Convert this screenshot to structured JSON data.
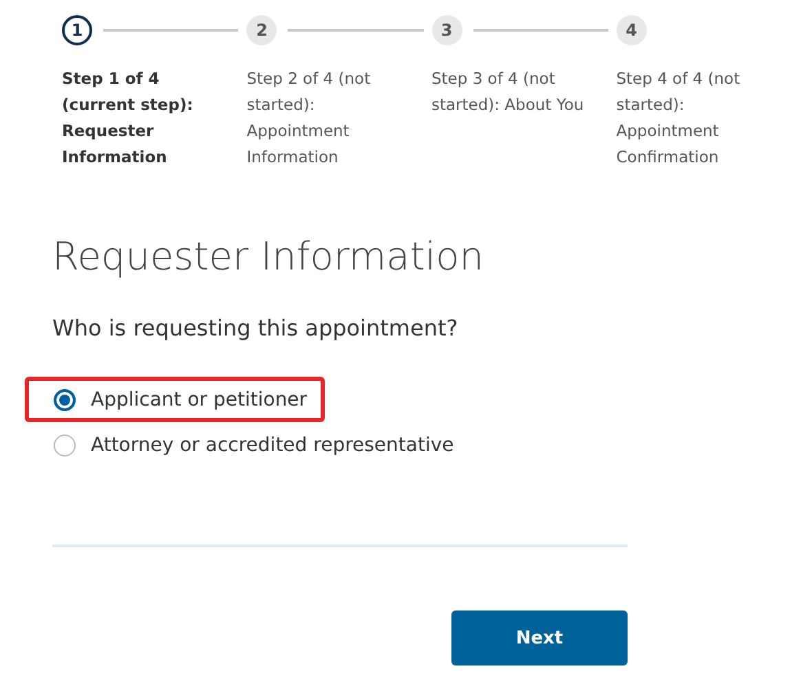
{
  "steps": [
    {
      "number": "1",
      "label": "Step 1 of 4 (current step): Requester Information",
      "current": true
    },
    {
      "number": "2",
      "label": "Step 2 of 4 (not started): Appointment Information",
      "current": false
    },
    {
      "number": "3",
      "label": "Step 3 of 4 (not started): About You",
      "current": false
    },
    {
      "number": "4",
      "label": "Step 4 of 4 (not started): Appointment Confirmation",
      "current": false
    }
  ],
  "heading": "Requester Information",
  "question": "Who is requesting this appointment?",
  "options": [
    {
      "label": "Applicant or petitioner",
      "selected": true,
      "highlighted": true
    },
    {
      "label": "Attorney or accredited representative",
      "selected": false,
      "highlighted": false
    }
  ],
  "next_button": "Next"
}
